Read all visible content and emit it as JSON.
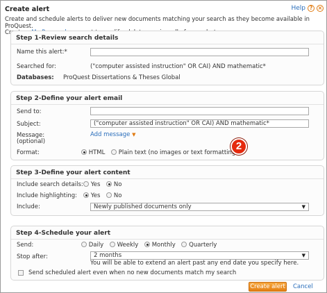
{
  "header": {
    "title": "Create alert",
    "help_label": "Help",
    "help_icon": "question-circle-icon",
    "close_icon": "close-circle-icon"
  },
  "intro": {
    "line1": "Create and schedule alerts to deliver new documents matching your search as they become available in ProQuest.",
    "line2_prefix": "Create a ",
    "line2_link": "My Research",
    "line2_suffix": " account to modify, delete, or view all of your alerts."
  },
  "step1": {
    "title": "Step 1-Review search details",
    "name_label": "Name this alert:*",
    "name_value": "",
    "searched_label": "Searched for:",
    "searched_value": "(\"computer assisted instruction\" OR CAI) AND mathematic*",
    "databases_label": "Databases:",
    "databases_value": "ProQuest Dissertations & Theses Global"
  },
  "step2": {
    "title": "Step 2-Define your alert email",
    "sendto_label": "Send to:",
    "sendto_value": "",
    "subject_label": "Subject:",
    "subject_value": "(\"computer assisted instruction\" OR CAI) AND mathematic*",
    "message_label": "Message:",
    "message_optional": "(optional)",
    "add_message": "Add message",
    "format_label": "Format:",
    "format_html": "HTML",
    "format_plain": "Plain text (no images or text formatting)",
    "format_selected": "HTML"
  },
  "step3": {
    "title": "Step 3-Define your alert content",
    "include_details_label": "Include search details:",
    "include_details_selected": "No",
    "include_highlighting_label": "Include highlighting:",
    "include_highlighting_selected": "Yes",
    "yes_label": "Yes",
    "no_label": "No",
    "include_label": "Include:",
    "include_value": "Newly published documents only"
  },
  "step4": {
    "title": "Step 4-Schedule your alert",
    "send_label": "Send:",
    "opt_daily": "Daily",
    "opt_weekly": "Weekly",
    "opt_monthly": "Monthly",
    "opt_quarterly": "Quarterly",
    "send_selected": "Monthly",
    "stop_label": "Stop after:",
    "stop_value": "2 months",
    "stop_hint": "You will be able to extend an alert past any end date you specify here.",
    "checkbox_label": "Send scheduled alert even when no new documents match my search"
  },
  "annotation": {
    "badge": "2",
    "badge_color": "#e52a0e"
  },
  "actions": {
    "create_label": "Create alert",
    "cancel_label": "Cancel"
  },
  "colors": {
    "accent": "#e07a10",
    "link": "#2a6ebb",
    "button": "#e47f12"
  }
}
